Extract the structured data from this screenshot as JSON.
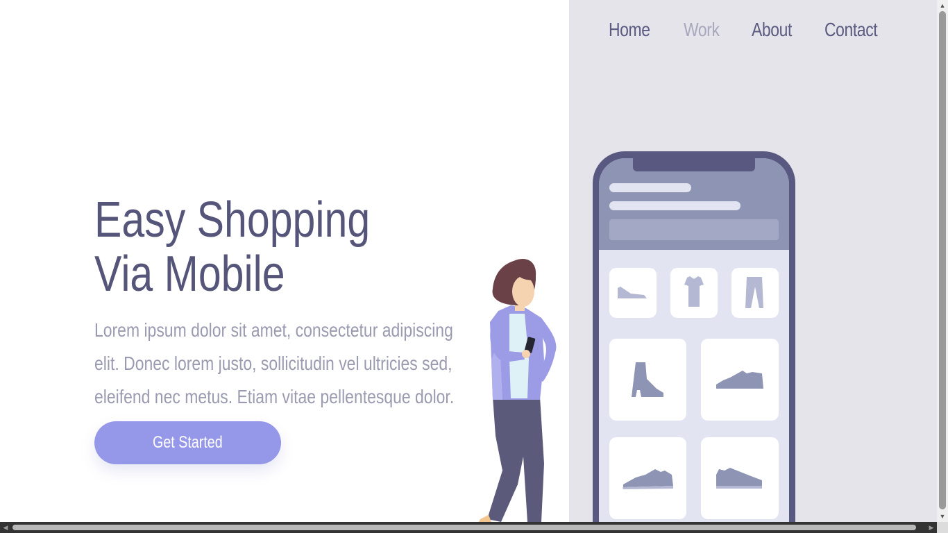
{
  "nav": {
    "items": [
      {
        "label": "Home",
        "active": false
      },
      {
        "label": "Work",
        "active": true
      },
      {
        "label": "About",
        "active": false
      },
      {
        "label": "Contact",
        "active": false
      }
    ]
  },
  "hero": {
    "title_line1": "Easy Shopping",
    "title_line2": "Via Mobile",
    "description": "Lorem ipsum dolor sit amet, consectetur adipiscing elit. Donec lorem justo, sollicitudin vel ultricies sed, eleifend nec metus. Etiam vitae pellentesque dolor.",
    "cta_label": "Get Started"
  },
  "illustration": {
    "phone_icons": [
      "sneaker-icon",
      "tshirt-icon",
      "pants-icon",
      "boot-icon",
      "shoe-icon",
      "sneaker-icon",
      "shoe-icon"
    ]
  },
  "colors": {
    "accent": "#9597e8",
    "heading": "#55557a",
    "panel_bg": "#e5e4ea"
  }
}
